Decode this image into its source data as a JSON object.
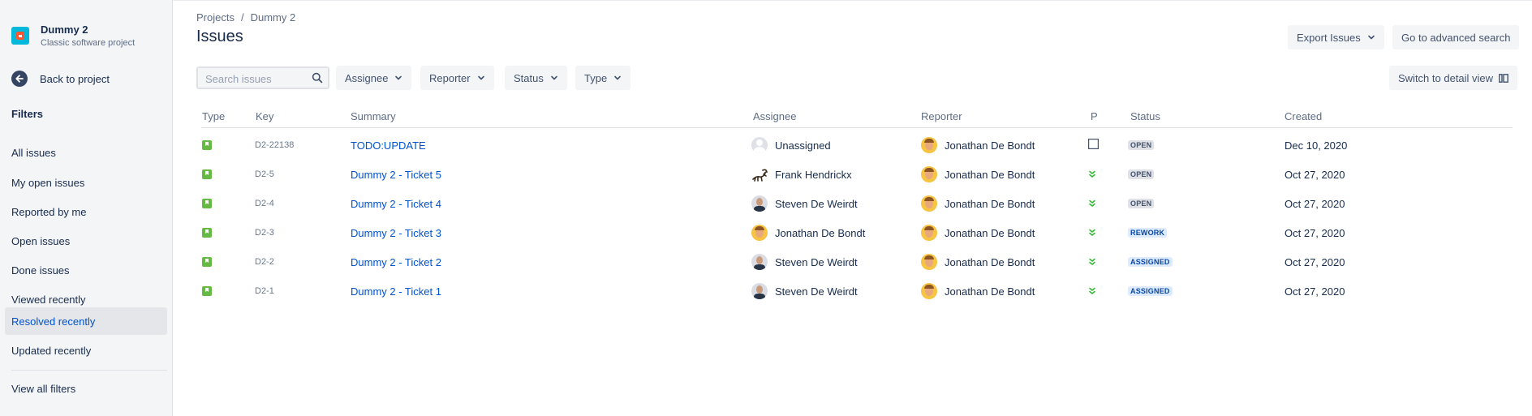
{
  "sidebar": {
    "project_name": "Dummy 2",
    "project_type": "Classic software project",
    "back_label": "Back to project",
    "filters_heading": "Filters",
    "items": [
      {
        "label": "All issues",
        "selected": false
      },
      {
        "label": "My open issues",
        "selected": false
      },
      {
        "label": "Reported by me",
        "selected": false
      },
      {
        "label": "Open issues",
        "selected": false
      },
      {
        "label": "Done issues",
        "selected": false
      },
      {
        "label": "Viewed recently",
        "selected": false
      },
      {
        "label": "Resolved recently",
        "selected": true
      },
      {
        "label": "Updated recently",
        "selected": false
      }
    ],
    "view_all_label": "View all filters"
  },
  "breadcrumb": [
    "Projects",
    "Dummy 2"
  ],
  "page_title": "Issues",
  "actions": {
    "export_label": "Export Issues",
    "advanced_search_label": "Go to advanced search",
    "switch_view_label": "Switch to detail view"
  },
  "filters": {
    "search_placeholder": "Search issues",
    "search_value": "",
    "assignee_label": "Assignee",
    "reporter_label": "Reporter",
    "status_label": "Status",
    "type_label": "Type"
  },
  "table": {
    "columns": {
      "type": "Type",
      "key": "Key",
      "summary": "Summary",
      "assignee": "Assignee",
      "reporter": "Reporter",
      "priority": "P",
      "status": "Status",
      "created": "Created"
    },
    "rows": [
      {
        "key": "D2-22138",
        "summary": "TODO:UPDATE",
        "assignee": "Unassigned",
        "assignee_avatar": "unassigned",
        "reporter": "Jonathan De Bondt",
        "priority_icon": "empty-checkbox-icon",
        "status": "OPEN",
        "created": "Dec 10, 2020"
      },
      {
        "key": "D2-5",
        "summary": "Dummy 2 - Ticket 5",
        "assignee": "Frank Hendrickx",
        "assignee_avatar": "frank",
        "reporter": "Jonathan De Bondt",
        "priority_icon": "double-chevron-down-icon",
        "status": "OPEN",
        "created": "Oct 27, 2020"
      },
      {
        "key": "D2-4",
        "summary": "Dummy 2 - Ticket 4",
        "assignee": "Steven De Weirdt",
        "assignee_avatar": "steven",
        "reporter": "Jonathan De Bondt",
        "priority_icon": "double-chevron-down-icon",
        "status": "OPEN",
        "created": "Oct 27, 2020"
      },
      {
        "key": "D2-3",
        "summary": "Dummy 2 - Ticket 3",
        "assignee": "Jonathan De Bondt",
        "assignee_avatar": "jonathan",
        "reporter": "Jonathan De Bondt",
        "priority_icon": "double-chevron-down-icon",
        "status": "REWORK",
        "created": "Oct 27, 2020"
      },
      {
        "key": "D2-2",
        "summary": "Dummy 2 - Ticket 2",
        "assignee": "Steven De Weirdt",
        "assignee_avatar": "steven",
        "reporter": "Jonathan De Bondt",
        "priority_icon": "double-chevron-down-icon",
        "status": "ASSIGNED",
        "created": "Oct 27, 2020"
      },
      {
        "key": "D2-1",
        "summary": "Dummy 2 - Ticket 1",
        "assignee": "Steven De Weirdt",
        "assignee_avatar": "steven",
        "reporter": "Jonathan De Bondt",
        "priority_icon": "double-chevron-down-icon",
        "status": "ASSIGNED",
        "created": "Oct 27, 2020"
      }
    ]
  },
  "colors": {
    "link": "#0052cc",
    "status_open_bg": "#dfe1e6",
    "status_open_text": "#42526e",
    "status_blue_bg": "#deebff",
    "status_blue_text": "#0747a6",
    "story_icon": "#65ba43",
    "priority_low": "#2eb82e"
  }
}
